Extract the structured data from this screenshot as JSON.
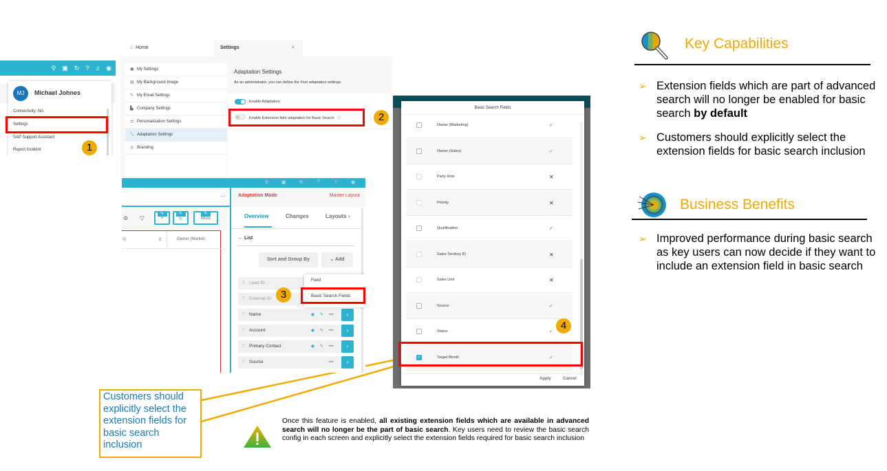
{
  "user_menu": {
    "shell_icons": [
      "search-icon",
      "feedback-icon",
      "history-icon",
      "help-icon",
      "notification-icon",
      "profile-icon"
    ],
    "avatar_initials": "MJ",
    "user_name": "Michael Johnes",
    "items": [
      "Connectivity: NA",
      "Settings",
      "SAP Support Assistant",
      "Report Incident"
    ],
    "step_badge": "1"
  },
  "settings": {
    "tabs": [
      {
        "label": "Home",
        "icon": "home-icon"
      },
      {
        "label": "Settings"
      }
    ],
    "close_glyph": "×",
    "sidebar": [
      {
        "label": "My Settings",
        "icon": "user-settings-icon"
      },
      {
        "label": "My Background Image",
        "icon": "image-icon"
      },
      {
        "label": "My Email Settings",
        "icon": "email-edit-icon"
      },
      {
        "label": "Company Settings",
        "icon": "building-icon"
      },
      {
        "label": "Personalization Settings",
        "icon": "sliders-icon"
      },
      {
        "label": "Adaptation Settings",
        "icon": "adaptation-icon",
        "selected": true
      },
      {
        "label": "Branding",
        "icon": "branding-icon"
      }
    ],
    "content_title": "Adaptation Settings",
    "content_desc": "As an administrator, you can define the Fiori adaptation settings.",
    "toggles": [
      {
        "label": "Enable Adaptation",
        "on": true
      },
      {
        "label": "Enable Extension field adaptation for Basic Search",
        "on": false
      }
    ],
    "info_glyph": "ⓘ",
    "step_badge": "2"
  },
  "adaptation": {
    "more_glyph": "···",
    "toolbar_buttons": [
      "+",
      "↻",
      "More"
    ],
    "grid_headers": [
      "s)",
      "Owner (Marketi"
    ],
    "mode_label": "Adaptation Mode",
    "layout_label": "Master Layout",
    "tabs": [
      "Overview",
      "Changes",
      "Layouts ›"
    ],
    "list_label": "← List",
    "sort_group_label": "Sort and Group By",
    "add_label": "⌄  Add",
    "fields": [
      {
        "label": "Lead ID",
        "dim": true
      },
      {
        "label": "External ID",
        "dim": true
      },
      {
        "label": "Name",
        "icons": "◉ ✎ 👓"
      },
      {
        "label": "Account",
        "icons": "◉ ✎ 👓"
      },
      {
        "label": "Primary Contact",
        "icons": "◉ ✎ 👓"
      },
      {
        "label": "Source",
        "icons": "👓"
      }
    ],
    "add_menu": [
      "Field",
      "Basic Search Fields"
    ],
    "step_badge": "3"
  },
  "basic_search_dialog": {
    "title": "Basic Search Fields",
    "rows": [
      {
        "name": "Owner (Marketing)",
        "checked": false,
        "disabled": false,
        "supported": true
      },
      {
        "name": "Owner (Sales)",
        "checked": false,
        "disabled": false,
        "supported": true
      },
      {
        "name": "Party Role",
        "checked": false,
        "disabled": true,
        "supported": false
      },
      {
        "name": "Priority",
        "checked": false,
        "disabled": true,
        "supported": false
      },
      {
        "name": "Qualification",
        "checked": false,
        "disabled": false,
        "supported": true
      },
      {
        "name": "Sales Territory ID",
        "checked": false,
        "disabled": true,
        "supported": false
      },
      {
        "name": "Sales Unit",
        "checked": false,
        "disabled": true,
        "supported": false
      },
      {
        "name": "Source",
        "checked": false,
        "disabled": false,
        "supported": true
      },
      {
        "name": "Status",
        "checked": false,
        "disabled": false,
        "supported": true
      },
      {
        "name": "Target Month",
        "checked": true,
        "disabled": false,
        "supported": true
      }
    ],
    "apply_label": "Apply",
    "cancel_label": "Cancel",
    "step_badge": "4"
  },
  "key_capabilities": {
    "title": "Key Capabilities",
    "icon": "magnifier-icon",
    "bullets": [
      {
        "text": "Extension fields which are part of advanced search will no longer be enabled for basic search ",
        "bold": "by default"
      },
      {
        "text": "Customers should explicitly select the extension fields for basic search inclusion",
        "bold": ""
      }
    ]
  },
  "business_benefits": {
    "title": "Business Benefits",
    "icon": "target-icon",
    "bullets": [
      {
        "text": "Improved performance during basic search as key users can now decide if they want to include an extension field in basic search"
      }
    ]
  },
  "callout": {
    "text": "Customers should explicitly select the extension fields for basic search inclusion"
  },
  "warning": {
    "icon": "warning-icon",
    "prefix": "Once this feature is enabled, ",
    "bold": "all existing extension fields which are available in advanced search will no longer be the part of basic search",
    "suffix": ". Key users need to review the basic search config in each screen and explicitly select the extension fields required for basic search inclusion"
  },
  "colors": {
    "accent_teal": "#2db3cf",
    "highlight_red": "#ff0000",
    "badge_gold": "#f0ab00",
    "adaptation_red": "#d04343",
    "callout_blue": "#1a7ab8"
  }
}
